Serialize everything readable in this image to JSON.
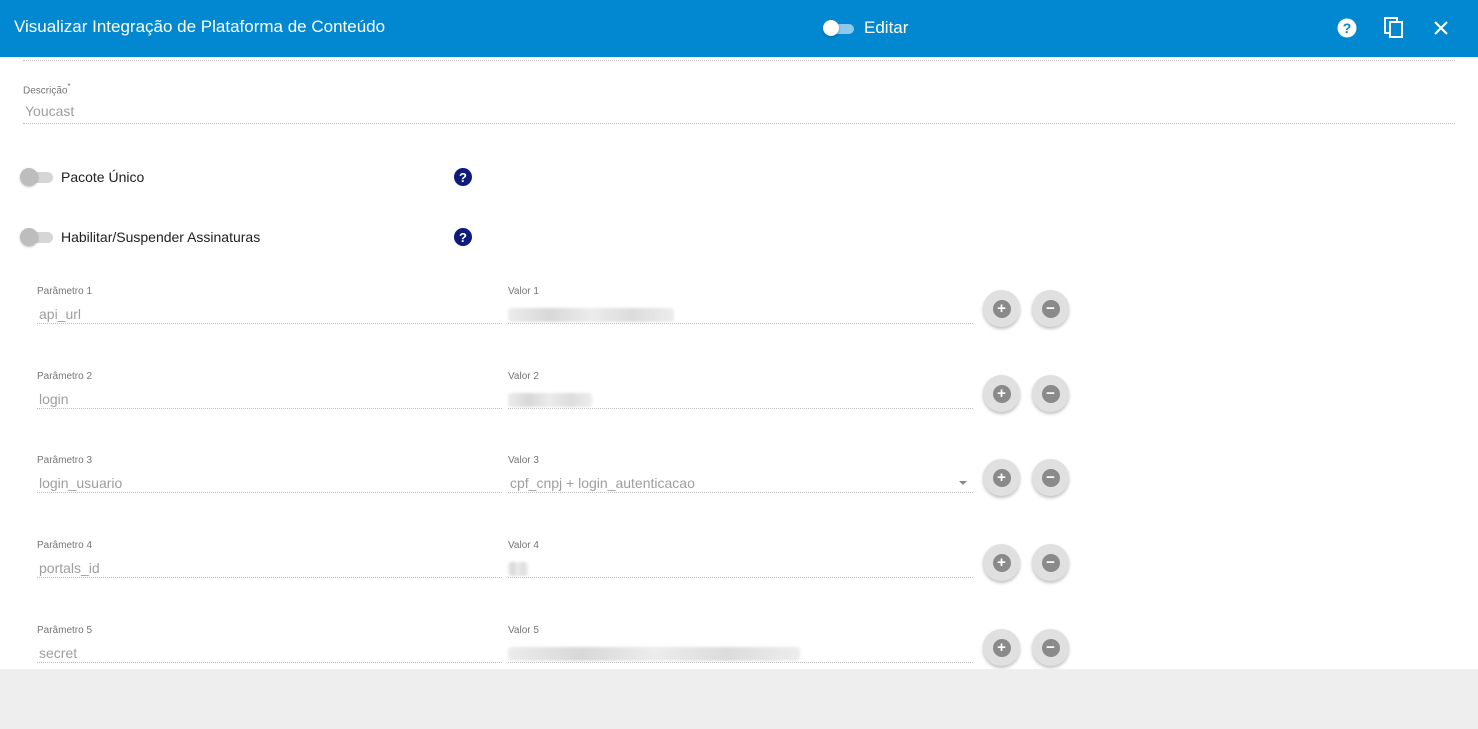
{
  "header": {
    "title": "Visualizar Integração de Plataforma de Conteúdo",
    "edit_label": "Editar",
    "edit_enabled": false,
    "help_icon": "help-circle-icon",
    "copy_icon": "copy-icon",
    "close_icon": "close-icon",
    "bg_color": "#0288d1"
  },
  "description": {
    "label": "Descrição",
    "required_mark": "*",
    "value": "Youcast"
  },
  "toggles": [
    {
      "label": "Pacote Único",
      "enabled": false
    },
    {
      "label": "Habilitar/Suspender Assinaturas",
      "enabled": false
    }
  ],
  "params": [
    {
      "param_label": "Parâmetro 1",
      "param_value": "api_url",
      "value_label": "Valor 1",
      "value": "",
      "value_redacted": true,
      "is_select": false
    },
    {
      "param_label": "Parâmetro 2",
      "param_value": "login",
      "value_label": "Valor 2",
      "value": "",
      "value_redacted": true,
      "is_select": false
    },
    {
      "param_label": "Parâmetro 3",
      "param_value": "login_usuario",
      "value_label": "Valor 3",
      "value": "cpf_cnpj + login_autenticacao",
      "value_redacted": false,
      "is_select": true
    },
    {
      "param_label": "Parâmetro 4",
      "param_value": "portals_id",
      "value_label": "Valor 4",
      "value": "",
      "value_redacted": true,
      "is_select": false
    },
    {
      "param_label": "Parâmetro 5",
      "param_value": "secret",
      "value_label": "Valor 5",
      "value": "",
      "value_redacted": true,
      "is_select": false
    }
  ],
  "row_buttons": {
    "add_icon": "plus-circle-icon",
    "remove_icon": "minus-circle-icon"
  }
}
